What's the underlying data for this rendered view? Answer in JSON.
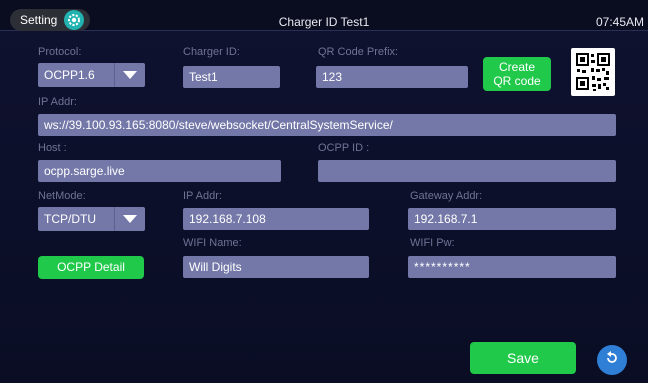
{
  "header": {
    "setting_label": "Setting",
    "title": "Charger ID Test1",
    "time": "07:45AM"
  },
  "protocol": {
    "label": "Protocol:",
    "value": "OCPP1.6"
  },
  "charger_id": {
    "label": "Charger ID:",
    "value": "Test1"
  },
  "qr_prefix": {
    "label": "QR Code Prefix:",
    "value": "123"
  },
  "create_qr_button": {
    "line1": "Create",
    "line2": "QR code"
  },
  "ip_addr": {
    "label": "IP Addr:",
    "value": "ws://39.100.93.165:8080/steve/websocket/CentralSystemService/"
  },
  "host": {
    "label": "Host :",
    "value": "ocpp.sarge.live"
  },
  "ocpp_id": {
    "label": "OCPP ID :",
    "value": ""
  },
  "netmode": {
    "label": "NetMode:",
    "value": "TCP/DTU"
  },
  "lan_ip": {
    "label": "IP Addr:",
    "value": "192.168.7.108"
  },
  "gateway": {
    "label": "Gateway Addr:",
    "value": "192.168.7.1"
  },
  "wifi_name": {
    "label": "WIFI Name:",
    "value": "Will Digits"
  },
  "wifi_pw": {
    "label": "WIFI Pw:",
    "value": "**********"
  },
  "ocpp_detail_button": "OCPP Detail",
  "save_button": "Save",
  "colors": {
    "background": "#0d1026",
    "field": "#7478a8",
    "accent_green": "#20c94a",
    "gear": "#22b3b0",
    "back_blue": "#2f7fd6"
  },
  "icons": {
    "settings": "gear-icon",
    "dropdown": "chevron-down-icon",
    "qr": "qr-code-icon",
    "back": "back-arrow-icon"
  }
}
